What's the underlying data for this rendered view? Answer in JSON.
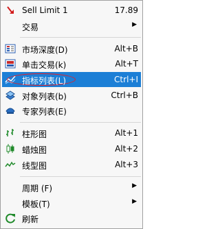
{
  "menu": {
    "items": [
      {
        "label": "Sell Limit 1",
        "shortcut": "17.89",
        "icon": "sell-arrow-icon"
      },
      {
        "label": "交易",
        "arrow": "▶"
      },
      {
        "label": "市场深度(D)",
        "shortcut": "Alt+B",
        "icon": "depth-of-market-icon"
      },
      {
        "label": "单击交易(k)",
        "shortcut": "Alt+T",
        "icon": "one-click-trading-icon"
      },
      {
        "label": "指标列表(L)",
        "shortcut": "Ctrl+I",
        "icon": "indicators-list-icon"
      },
      {
        "label": "对象列表(b)",
        "shortcut": "Ctrl+B",
        "icon": "objects-list-icon"
      },
      {
        "label": "专家列表(E)",
        "icon": "experts-list-icon"
      },
      {
        "label": "柱形图",
        "shortcut": "Alt+1",
        "icon": "bar-chart-icon"
      },
      {
        "label": "蜡烛图",
        "shortcut": "Alt+2",
        "icon": "candlestick-chart-icon"
      },
      {
        "label": "线型图",
        "shortcut": "Alt+3",
        "icon": "line-chart-icon"
      },
      {
        "label": "周期 (F)",
        "arrow": "▶"
      },
      {
        "label": "模板(T)",
        "arrow": "▶"
      },
      {
        "label": "刷新",
        "icon": "refresh-icon"
      }
    ]
  },
  "colors": {
    "highlight": "#1c7fd6",
    "annotation": "#e0202a"
  }
}
